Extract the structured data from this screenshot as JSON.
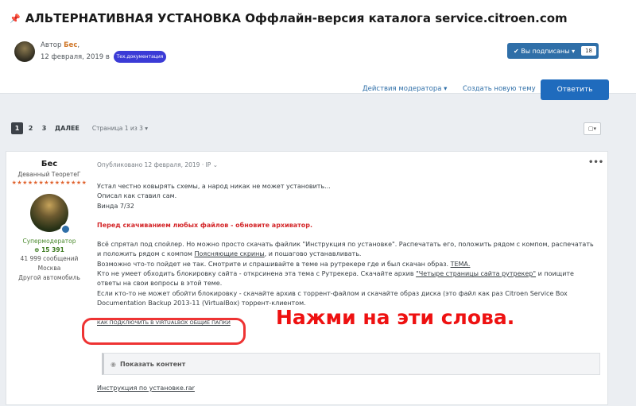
{
  "topic": {
    "title": "АЛЬТЕРНАТИВНАЯ УСТАНОВКА Оффлайн-версия каталога service.citroen.com",
    "author_prefix": "Автор",
    "author_name": "Бес",
    "date": "12 февраля, 2019 в",
    "tag": "Тех.документация",
    "subscribe_label": "Вы подписаны",
    "subscribe_count": "18"
  },
  "actions": {
    "mod_actions": "Действия модератора",
    "new_topic": "Создать новую тему",
    "reply": "Ответить"
  },
  "pagination": {
    "pages": [
      "1",
      "2",
      "3"
    ],
    "next": "ДАЛЕЕ",
    "info": "Страница 1 из 3"
  },
  "post": {
    "author": {
      "name": "Бес",
      "rank": "Деванный ТеоретеГ",
      "stars": "★★★★★★★★★★★★★★",
      "role": "Супермодератор",
      "reputation": "15 391",
      "posts": "41 999 сообщений",
      "city": "Москва",
      "car": "Другой автомобиль"
    },
    "meta": "Опубликовано 12 февраля, 2019 · IP",
    "lines": [
      "Устал честно ковырять схемы, а народ никак не может установить...",
      "Описал как ставил сам.",
      "Винда 7/32"
    ],
    "warning": "Перед скачиванием любых файлов - обновите архиватор.",
    "p1_a": "Всё спрятал под спойлер. Но можно просто скачать файлик \"Инструкция по установке\". Распечатать его, положить рядом с компом, распечатать и положить рядом с компом ",
    "p1_link": "Поясняющие скрины",
    "p1_b": ", и пошагово устанавливать.",
    "p2_a": "Возможно что-то пойдет не так. Смотрите и спрашивайте в теме на рутрекере где и был скачан образ. ",
    "p2_link": "ТЕМА.",
    "p3_a": "Кто не умеет обходить блокировку сайта -  открсинена эта тема с Рутрекера. Скачайте архив ",
    "p3_link": "\"Четыре страницы сайта рутрекер\"",
    "p3_b": " и поищите ответы на свои вопросы в этой теме.",
    "p4": "Если кто-то не может обойти блокировку - скачайте  архив с торрент-файлом и скачайте образ диска (это файл как раз Citroen Service Box Documentation Backup 2013-11 (VirtualBox) торрент-клиентом.",
    "vbox_link": "КАК ПОДКЛЮЧИТЬ В VIRTUALBOX ОБЩИЕ ПАПКИ",
    "annotation": "Нажми на эти слова.",
    "spoiler_label": "Показать контент",
    "file_link": "Инструкция по установке.rar"
  },
  "colors": {
    "accent": "#1f6bbd",
    "annotation_red": "#e11111",
    "warning_red": "#d4282b"
  }
}
